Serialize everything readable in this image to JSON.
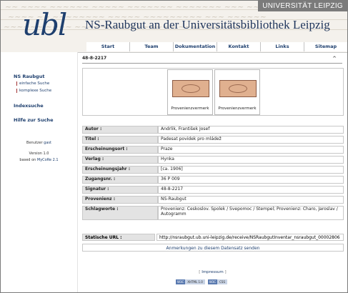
{
  "header": {
    "logo_text": "ubl",
    "title": "NS-Raubgut an der Universitätsbibliothek Leipzig",
    "university_label": "UNIVERSITÄT LEIPZIG"
  },
  "nav": {
    "items": [
      "Start",
      "Team",
      "Dokumentation",
      "Kontakt",
      "Links",
      "Sitemap"
    ]
  },
  "sidebar": {
    "ns_raubgut": "NS Raubgut",
    "simple_search": "einfache Suche",
    "complex_search": "komplexe Suche",
    "indexsuche": "Indexsuche",
    "help": "Hilfe zur Suche",
    "user_label": "Benutzer",
    "user_name": "gast",
    "version": "Version 1.0",
    "based_on": "based on",
    "mycore": "MyCoRe 2.1"
  },
  "record": {
    "id": "48-8-2217",
    "up_symbol": "^",
    "thumb_captions": [
      "Provenienzvermerk",
      "Provenienzvermerk"
    ],
    "rows": [
      {
        "label": "Autor :",
        "value": "Andrlik, František Josef"
      },
      {
        "label": "Titel :",
        "value": "Padesat povidek pro mládež"
      },
      {
        "label": "Erscheinungsort :",
        "value": "Praze"
      },
      {
        "label": "Verlag :",
        "value": "Hynka"
      },
      {
        "label": "Erscheinungsjahr :",
        "value": "[ca. 1906]"
      },
      {
        "label": "Zugangsnr. :",
        "value": "36 P 009"
      },
      {
        "label": "Signatur :",
        "value": "48-8-2217"
      },
      {
        "label": "Provenienz :",
        "value": "NS-Raubgut"
      },
      {
        "label": "Schlagworte :",
        "value": "Provenienz: Ceskoslov. Spolek / Svepomoc / Stempel; Provenienz: Charo, Jaroslav / Autogramm"
      }
    ],
    "static_url_label": "Statische URL :",
    "static_url": "http://nsraubgut.ub.uni-leipzig.de/receive/NSRaubgutInventar_nsraubgut_00002806",
    "remarks_link": "Anmerkungen zu diesem Datensatz senden"
  },
  "footer": {
    "impressum_open": "[",
    "impressum": "Impressum",
    "impressum_close": "]",
    "badge1_a": "W3C",
    "badge1_b": "XHTML 1.0",
    "badge2_a": "W3C",
    "badge2_b": "CSS"
  }
}
